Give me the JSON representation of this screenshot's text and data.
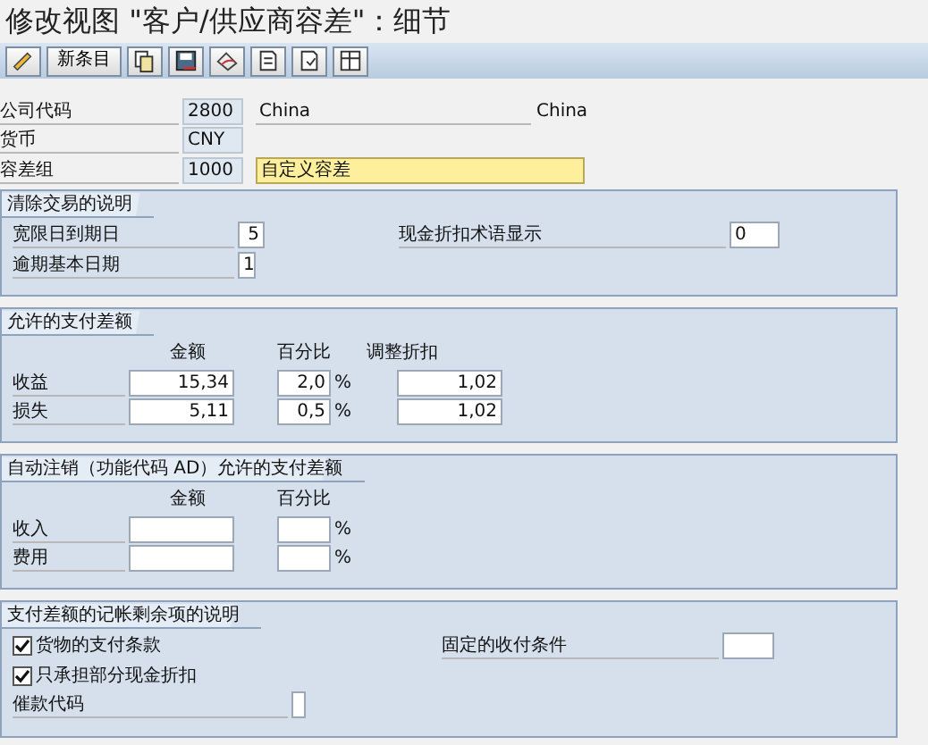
{
  "window": {
    "title": "修改视图 \"客户/供应商容差\"：细节"
  },
  "toolbar": {
    "new_entry_button": "新条目"
  },
  "header_fields": [
    {
      "label": "公司代码",
      "value": "2800",
      "description": "China",
      "highlighted": false,
      "extra": "China"
    },
    {
      "label": "货币",
      "value": "CNY"
    },
    {
      "label": "容差组",
      "value": "1000",
      "description": "自定义容差",
      "highlighted": true
    }
  ],
  "groups": [
    {
      "kind": "fields",
      "title": "清除交易的说明",
      "left": [
        {
          "label": "宽限日到期日",
          "value": "5"
        },
        {
          "label": "逾期基本日期",
          "value": "1"
        }
      ],
      "right": [
        {
          "label": "现金折扣术语显示",
          "value": "0"
        }
      ]
    },
    {
      "kind": "table",
      "title": "允许的支付差额",
      "columns": [
        "金额",
        "百分比",
        "调整折扣"
      ],
      "rows": [
        {
          "label": "收益",
          "amount": "15,34",
          "percent": "2,0",
          "percent_sign": "%",
          "adjustment": "1,02"
        },
        {
          "label": "损失",
          "amount": "5,11",
          "percent": "0,5",
          "percent_sign": "%",
          "adjustment": "1,02"
        }
      ]
    },
    {
      "kind": "table",
      "title": "自动注销（功能代码 AD）允许的支付差额",
      "columns": [
        "金额",
        "百分比"
      ],
      "rows": [
        {
          "label": "收入",
          "percent_sign": "%"
        },
        {
          "label": "费用",
          "percent_sign": "%"
        }
      ]
    },
    {
      "kind": "options",
      "title": "支付差额的记帐剩余项的说明",
      "checkboxes": [
        {
          "label": "货物的支付条款",
          "checked": true
        },
        {
          "label": "只承担部分现金折扣",
          "checked": true
        }
      ],
      "right": [
        {
          "label": "固定的收付条件"
        }
      ],
      "bottom": [
        {
          "label": "催款代码"
        }
      ]
    }
  ]
}
